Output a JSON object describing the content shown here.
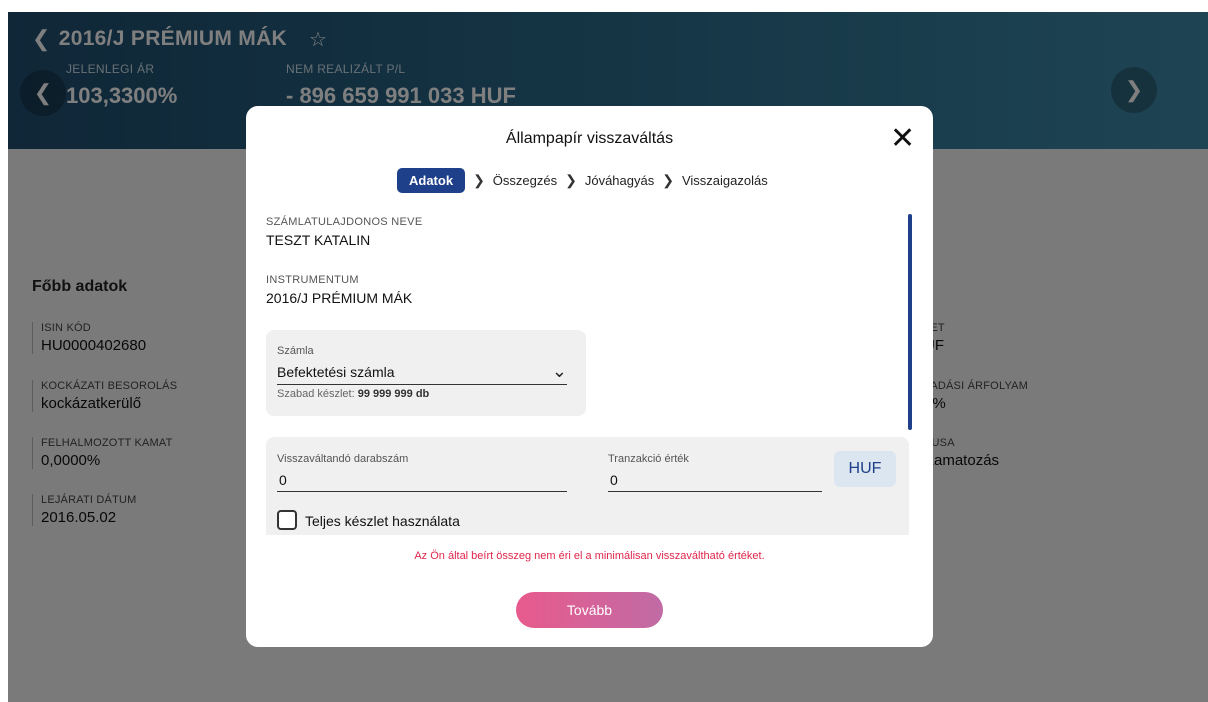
{
  "header": {
    "title": "2016/J PRÉMIUM MÁK",
    "current_price_label": "JELENLEGI ÁR",
    "current_price_value": "103,3300%",
    "unrealized_pl_label": "NEM REALIZÁLT P/L",
    "unrealized_pl_value": "- 896 659 991 033 HUF"
  },
  "details": {
    "section_title": "Főbb adatok",
    "left": [
      {
        "label": "ISIN KÓD",
        "value": "HU0000402680"
      },
      {
        "label": "KOCKÁZATI BESOROLÁS",
        "value": "kockázatkerülő"
      },
      {
        "label": "FELHALMOZOTT KAMAT",
        "value": "0,0000%"
      },
      {
        "label": "LEJÁRATI DÁTUM",
        "value": "2016.05.02"
      }
    ],
    "right": [
      {
        "label": "LET",
        "value": "UF"
      },
      {
        "label": "LADÁSI ÁRFOLYAM",
        "value": "0%"
      },
      {
        "label": "PUSA",
        "value": "Kamatozás"
      }
    ]
  },
  "modal": {
    "title": "Állampapír visszaváltás",
    "steps": [
      "Adatok",
      "Összegzés",
      "Jóváhagyás",
      "Visszaigazolás"
    ],
    "holder_label": "SZÁMLATULAJDONOS NEVE",
    "holder_value": "TESZT KATALIN",
    "instrument_label": "INSTRUMENTUM",
    "instrument_value": "2016/J PRÉMIUM MÁK",
    "account": {
      "label": "Számla",
      "value": "Befektetési számla",
      "free_label": "Szabad készlet: ",
      "free_value": "99 999 999 db"
    },
    "quantity": {
      "label": "Visszaváltandó darabszám",
      "value": "0"
    },
    "transaction": {
      "label": "Tranzakció érték",
      "value": "0",
      "currency": "HUF"
    },
    "full_stock_label": "Teljes készlet használata",
    "error": "Az Ön által beírt összeg nem éri el a minimálisan visszaváltható értéket.",
    "submit_label": "Tovább"
  }
}
